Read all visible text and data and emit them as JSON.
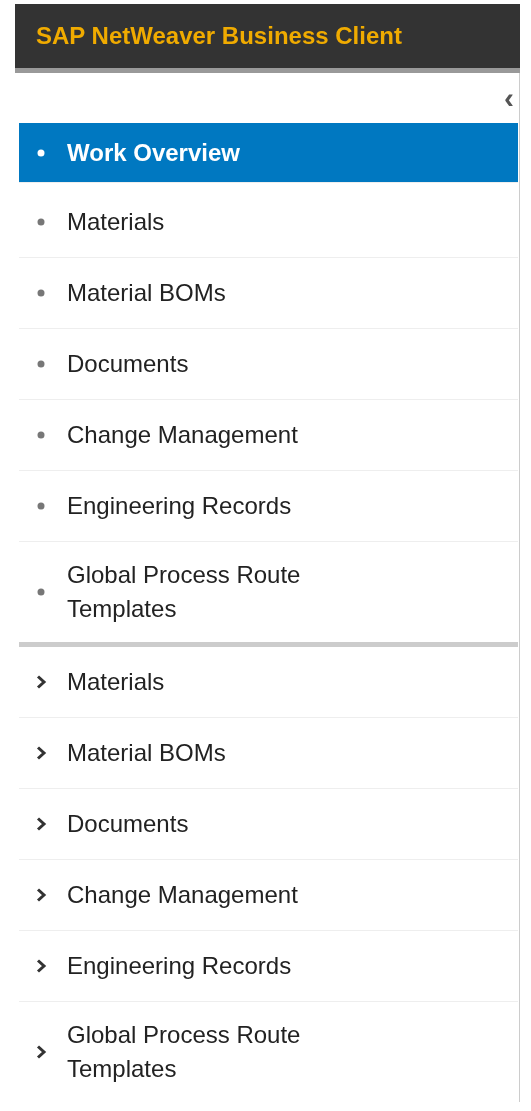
{
  "header": {
    "title": "SAP NetWeaver Business Client"
  },
  "collapse_button": {
    "label": "‹"
  },
  "pages": [
    {
      "label": "Work Overview",
      "selected": true
    },
    {
      "label": "Materials",
      "selected": false
    },
    {
      "label": "Material BOMs",
      "selected": false
    },
    {
      "label": "Documents",
      "selected": false
    },
    {
      "label": "Change Management",
      "selected": false
    },
    {
      "label": "Engineering Records",
      "selected": false
    },
    {
      "label": "Global Process Route Templates",
      "selected": false
    }
  ],
  "folders": [
    {
      "label": "Materials",
      "expanded": false
    },
    {
      "label": "Material BOMs",
      "expanded": false
    },
    {
      "label": "Documents",
      "expanded": false
    },
    {
      "label": "Change Management",
      "expanded": false
    },
    {
      "label": "Engineering Records",
      "expanded": false
    },
    {
      "label": "Global Process Route Templates",
      "expanded": false
    }
  ]
}
